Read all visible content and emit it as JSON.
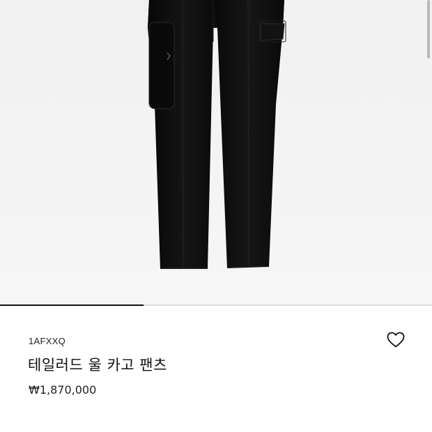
{
  "product": {
    "sku": "1AFXXQ",
    "name": "테일러드 울 카고 팬츠",
    "price": "₩1,870,000"
  },
  "gallery": {
    "image_subject": "black-tailored-cargo-pants",
    "progress_fraction": 0.333
  },
  "colors": {
    "garment": "#0f0f0f",
    "background": "#f3f3f3",
    "progress_fill": "#111111",
    "progress_track": "#dcdcdc"
  },
  "icons": {
    "wishlist": "heart-outline-icon"
  }
}
